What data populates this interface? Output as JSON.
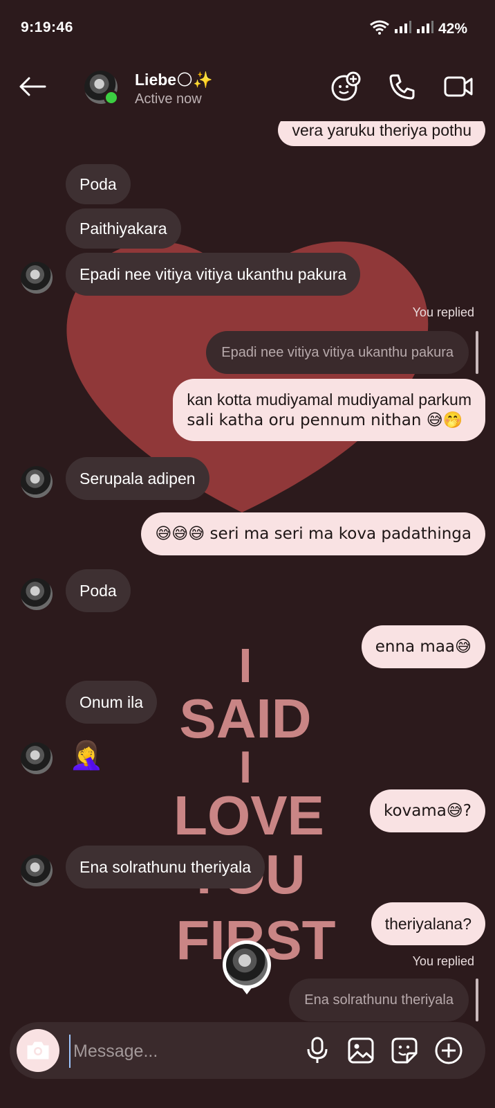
{
  "status_bar": {
    "time": "9:19:46",
    "battery": "42%"
  },
  "header": {
    "name": "Liebe🌕✨",
    "status": "Active now"
  },
  "messages": {
    "m0": "vera yaruku theriya pothu",
    "m1": "Poda",
    "m2": "Paithiyakara",
    "m3": "Epadi nee vitiya vitiya ukanthu pakura",
    "replied_label_1": "You replied",
    "reply_quote_1": "Epadi nee vitiya vitiya ukanthu pakura",
    "m4_line1": "kan kotta mudiyamal mudiyamal parkum",
    "m4_line2": "sali katha oru pennum nithan 😅🤭",
    "m5": "Serupala adipen",
    "m6": "😅😅😅 seri ma seri ma kova padathinga",
    "m7": "Poda",
    "m8": "enna maa😅",
    "m9": "Onum ila",
    "m10": "🤦‍♀️",
    "m11": "kovama😅?",
    "m12": "Ena solrathunu theriyala",
    "m13": "theriyalana?",
    "replied_label_2": "You replied",
    "reply_quote_2": "Ena solrathunu theriyala"
  },
  "wallpaper": {
    "lines": [
      "I",
      "SAID",
      "I",
      "LOVE",
      "YOU",
      "FIRST"
    ],
    "heart_color": "#a23e3e",
    "text_color": "#c98585"
  },
  "composer": {
    "placeholder": "Message..."
  },
  "icons": {
    "back": "arrow-left-icon",
    "effects": "smiley-plus-icon",
    "call": "phone-icon",
    "video": "video-camera-icon",
    "camera": "camera-icon",
    "mic": "microphone-icon",
    "gallery": "image-icon",
    "sticker": "sticker-icon",
    "more": "plus-circle-icon"
  },
  "colors": {
    "background": "#2c1a1c",
    "incoming_bubble": "#3e3032",
    "outgoing_bubble": "#f9e2e3",
    "online": "#3ccf42"
  }
}
